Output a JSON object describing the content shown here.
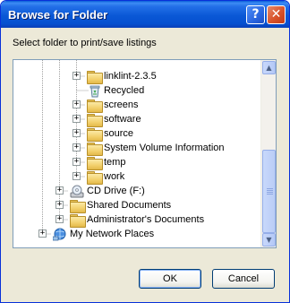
{
  "window": {
    "title": "Browse for Folder",
    "help_label": "?",
    "close_label": "✕"
  },
  "prompt": "Select folder to print/save listings",
  "tree": {
    "items": [
      {
        "label": "linklint-2.3.5",
        "icon": "folder-icon",
        "expander": "+"
      },
      {
        "label": "Recycled",
        "icon": "recycle-bin-icon",
        "expander": ""
      },
      {
        "label": "screens",
        "icon": "folder-icon",
        "expander": "+"
      },
      {
        "label": "software",
        "icon": "folder-icon",
        "expander": "+"
      },
      {
        "label": "source",
        "icon": "folder-icon",
        "expander": "+"
      },
      {
        "label": "System Volume Information",
        "icon": "folder-icon",
        "expander": "+"
      },
      {
        "label": "temp",
        "icon": "folder-icon",
        "expander": "+"
      },
      {
        "label": "work",
        "icon": "folder-icon",
        "expander": "+"
      },
      {
        "label": "CD Drive (F:)",
        "icon": "cd-drive-icon",
        "expander": "+"
      },
      {
        "label": "Shared Documents",
        "icon": "folder-icon",
        "expander": "+"
      },
      {
        "label": "Administrator's Documents",
        "icon": "folder-icon",
        "expander": "+"
      },
      {
        "label": "My Network Places",
        "icon": "network-places-icon",
        "expander": "+"
      }
    ]
  },
  "buttons": {
    "ok_label": "OK",
    "cancel_label": "Cancel"
  },
  "colors": {
    "title_bar": "#0a58d6",
    "dialog_bg": "#ece9d8",
    "tree_border": "#7f9db9",
    "button_border": "#003c74"
  }
}
